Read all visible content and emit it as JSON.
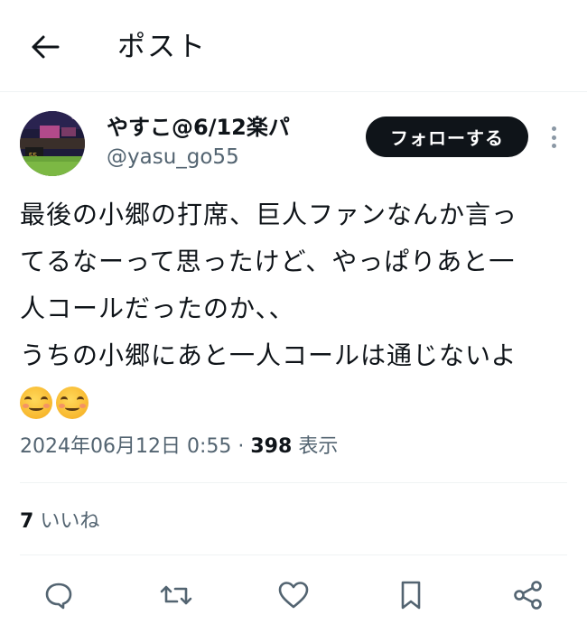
{
  "header": {
    "title": "ポスト"
  },
  "author": {
    "display_name": "やすこ@6/12楽パ",
    "handle": "@yasu_go55",
    "follow_label": "フォローする"
  },
  "tweet": {
    "lines": [
      "最後の小郷の打席、巨人ファンなんか言っ",
      "てるなーって思ったけど、やっぱりあと一",
      "人コールだったのか、、",
      "うちの小郷にあと一人コールは通じないよ"
    ],
    "emojis": [
      "smiling-face-with-blush-emoji",
      "smiling-face-with-blush-emoji"
    ]
  },
  "meta": {
    "timestamp": "2024年06月12日 0:55",
    "separator": "·",
    "views_count": "398",
    "views_label": "表示"
  },
  "engagement": {
    "likes_count": "7",
    "likes_label": "いいね"
  },
  "colors": {
    "primary_text": "#0f1419",
    "secondary_text": "#536471",
    "divider": "#eff3f4",
    "follow_button_bg": "#0f1419"
  }
}
